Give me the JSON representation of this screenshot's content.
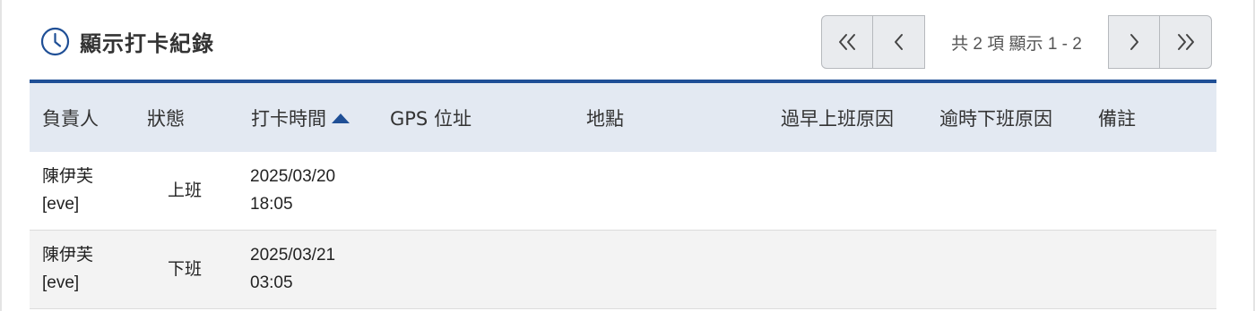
{
  "header": {
    "title": "顯示打卡紀錄",
    "icon": "clock-icon",
    "accent_color": "#1f4f96"
  },
  "pager": {
    "info": "共 2 項 顯示 1 - 2",
    "first_icon": "double-chevron-left-icon",
    "prev_icon": "chevron-left-icon",
    "next_icon": "chevron-right-icon",
    "last_icon": "double-chevron-right-icon"
  },
  "table": {
    "columns": [
      "負責人",
      "狀態",
      "打卡時間",
      "GPS 位址",
      "地點",
      "過早上班原因",
      "逾時下班原因",
      "備註"
    ],
    "sorted_column": "打卡時間",
    "sort_direction": "ascending",
    "rows": [
      {
        "owner_name": "陳伊芙",
        "owner_id": "[eve]",
        "status": "上班",
        "date": "2025/03/20",
        "time": "18:05",
        "gps": "",
        "location": "",
        "early_reason": "",
        "late_reason": "",
        "note": ""
      },
      {
        "owner_name": "陳伊芙",
        "owner_id": "[eve]",
        "status": "下班",
        "date": "2025/03/21",
        "time": "03:05",
        "gps": "",
        "location": "",
        "early_reason": "",
        "late_reason": "",
        "note": ""
      }
    ]
  }
}
